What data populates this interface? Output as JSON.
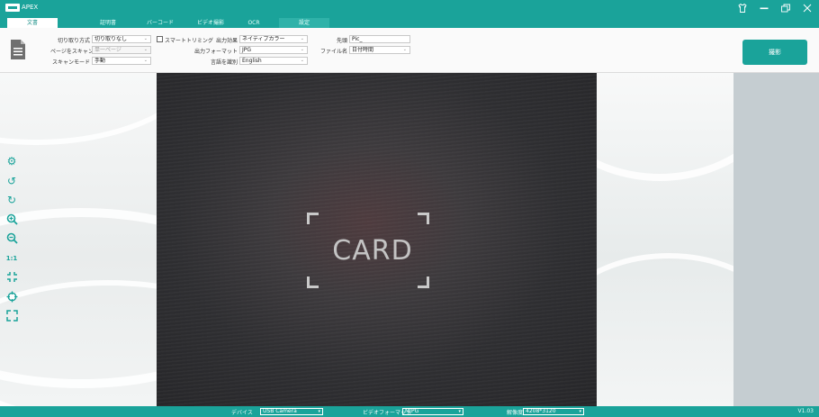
{
  "app": {
    "title": "APEX",
    "version": "V1.03"
  },
  "window_controls": [
    "shirt-icon",
    "minimize-icon",
    "restore-icon",
    "close-icon"
  ],
  "tabs": [
    {
      "label": "文書",
      "active": true
    },
    {
      "label": "証明書"
    },
    {
      "label": "バーコード"
    },
    {
      "label": "ビデオ撮影"
    },
    {
      "label": "OCR"
    },
    {
      "label": "設定"
    }
  ],
  "toolbar": {
    "crop_mode": {
      "label": "切り取り方式",
      "value": "切り取りなし"
    },
    "page_scan": {
      "label": "ページをスキャン",
      "value": "単一ページ"
    },
    "scan_mode": {
      "label": "スキャンモード",
      "value": "手動"
    },
    "smart_trim": {
      "label": "スマートトリミング",
      "checked": false
    },
    "output_effect": {
      "label": "出力効果",
      "value": "ネイティブカラー"
    },
    "output_format": {
      "label": "出力フォーマット",
      "value": "JPG"
    },
    "language": {
      "label": "言語を識別",
      "value": "English"
    },
    "prefix": {
      "label": "先頭",
      "value": "Pic_"
    },
    "file_name": {
      "label": "ファイル名",
      "value": "日付時間"
    },
    "capture_label": "撮影"
  },
  "viewport": {
    "overlay_text": "CARD"
  },
  "left_tools": [
    "settings-icon",
    "rotate-left-icon",
    "rotate-right-icon",
    "zoom-in-icon",
    "zoom-out-icon",
    "actual-size-icon",
    "fit-screen-icon",
    "focus-icon",
    "fullscreen-icon"
  ],
  "left_tools_text": {
    "actual_size": "1:1"
  },
  "statusbar": {
    "device": {
      "label": "デバイス",
      "value": "USB Camera"
    },
    "video_format": {
      "label": "ビデオフォーマット",
      "value": "MJPG"
    },
    "resolution": {
      "label": "解像度",
      "value": "4208*3120"
    }
  },
  "colors": {
    "accent": "#1aa39a",
    "side_panel": "#c5cdd1"
  }
}
